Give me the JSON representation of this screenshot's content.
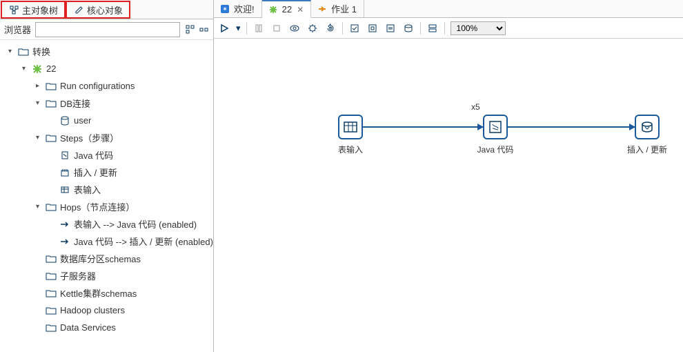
{
  "left_tabs": {
    "main_tree": "主对象树",
    "core_objects": "核心对象"
  },
  "filter": {
    "label": "浏览器",
    "placeholder": ""
  },
  "tree": {
    "root": "转换",
    "trans": "22",
    "run_conf": "Run configurations",
    "db_conn": "DB连接",
    "db_user": "user",
    "steps": "Steps（步骤）",
    "step_java": "Java 代码",
    "step_insert": "插入 / 更新",
    "step_table": "表输入",
    "hops": "Hops（节点连接）",
    "hop1": "表输入 --> Java 代码 (enabled)",
    "hop2": "Java 代码 --> 插入 / 更新 (enabled)",
    "partition": "数据库分区schemas",
    "slave": "子服务器",
    "cluster": "Kettle集群schemas",
    "hadoop": "Hadoop clusters",
    "data_services": "Data Services"
  },
  "editor_tabs": {
    "welcome": "欢迎!",
    "trans": "22",
    "job": "作业 1"
  },
  "toolbar": {
    "zoom": "100%"
  },
  "canvas": {
    "step1_label": "表输入",
    "step2_label": "Java 代码",
    "step3_label": "插入 / 更新",
    "hop_multiplier": "x5"
  }
}
